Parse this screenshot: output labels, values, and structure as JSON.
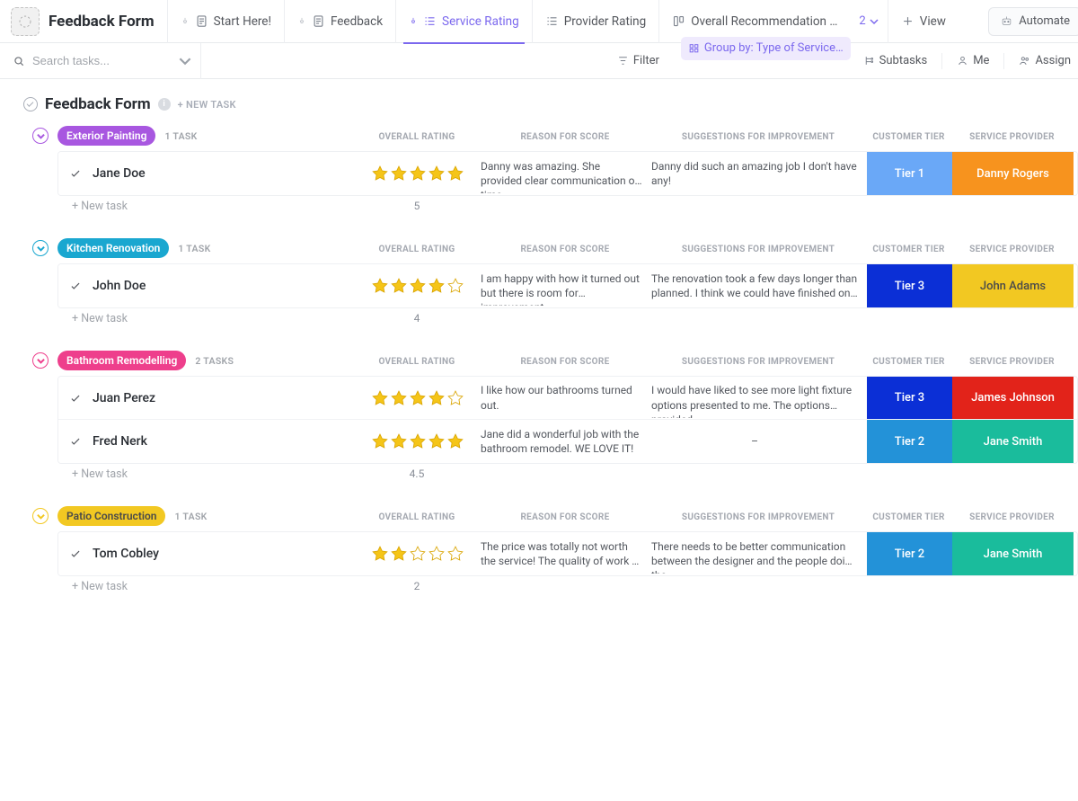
{
  "header": {
    "title": "Feedback Form",
    "tabs": [
      {
        "label": "Start Here!"
      },
      {
        "label": "Feedback"
      },
      {
        "label": "Service Rating"
      },
      {
        "label": "Provider Rating"
      },
      {
        "label": "Overall Recommendation …"
      }
    ],
    "more_count": "2",
    "view_label": "View",
    "automate_label": "Automate"
  },
  "toolbar": {
    "search_placeholder": "Search tasks...",
    "filter": "Filter",
    "group_by": "Group by: Type of Service…",
    "subtasks": "Subtasks",
    "me": "Me",
    "assign": "Assign"
  },
  "page": {
    "title": "Feedback Form",
    "new_task_label": "+ NEW TASK"
  },
  "columns": {
    "rating": "OVERALL RATING",
    "reason": "REASON FOR SCORE",
    "suggest": "SUGGESTIONS FOR IMPROVEMENT",
    "tier": "CUSTOMER TIER",
    "provider": "SERVICE PROVIDER"
  },
  "labels": {
    "new_task": "+ New task"
  },
  "groups": [
    {
      "name": "Exterior Painting",
      "count": "1 TASK",
      "color": "c-purple",
      "avg": "5",
      "rows": [
        {
          "assignee": "Jane Doe",
          "stars": 5,
          "reason": "Danny was amazing. She provided clear communication of time…",
          "suggest": "Danny did such an amazing job I don't have any!",
          "tier": "Tier 1",
          "tier_cls": "t1",
          "provider": "Danny Rogers",
          "prov_cls": "orange"
        }
      ]
    },
    {
      "name": "Kitchen Renovation",
      "count": "1 TASK",
      "color": "c-blue2",
      "avg": "4",
      "rows": [
        {
          "assignee": "John Doe",
          "stars": 4,
          "reason": "I am happy with how it turned out but there is room for improvement",
          "suggest": "The renovation took a few days longer than planned. I think we could have finished on …",
          "tier": "Tier 3",
          "tier_cls": "t3",
          "provider": "John Adams",
          "prov_cls": "yellow"
        }
      ]
    },
    {
      "name": "Bathroom Remodelling",
      "count": "2 TASKS",
      "color": "c-pink",
      "avg": "4.5",
      "rows": [
        {
          "assignee": "Juan Perez",
          "stars": 4,
          "reason": "I like how our bathrooms turned out.",
          "suggest": "I would have liked to see more light fixture options presented to me. The options provided…",
          "tier": "Tier 3",
          "tier_cls": "t3",
          "provider": "James Johnson",
          "prov_cls": "red"
        },
        {
          "assignee": "Fred Nerk",
          "stars": 5,
          "reason": "Jane did a wonderful job with the bathroom remodel. WE LOVE IT!",
          "suggest": "–",
          "suggest_center": true,
          "tier": "Tier 2",
          "tier_cls": "t2",
          "provider": "Jane Smith",
          "prov_cls": "teal"
        }
      ]
    },
    {
      "name": "Patio Construction",
      "count": "1 TASK",
      "color": "c-yellow",
      "avg": "2",
      "rows": [
        {
          "assignee": "Tom Cobley",
          "stars": 2,
          "reason": "The price was totally not worth the service! The quality of work …",
          "suggest": "There needs to be better communication between the designer and the people doing the…",
          "tier": "Tier 2",
          "tier_cls": "t2",
          "provider": "Jane Smith",
          "prov_cls": "teal"
        }
      ]
    }
  ]
}
